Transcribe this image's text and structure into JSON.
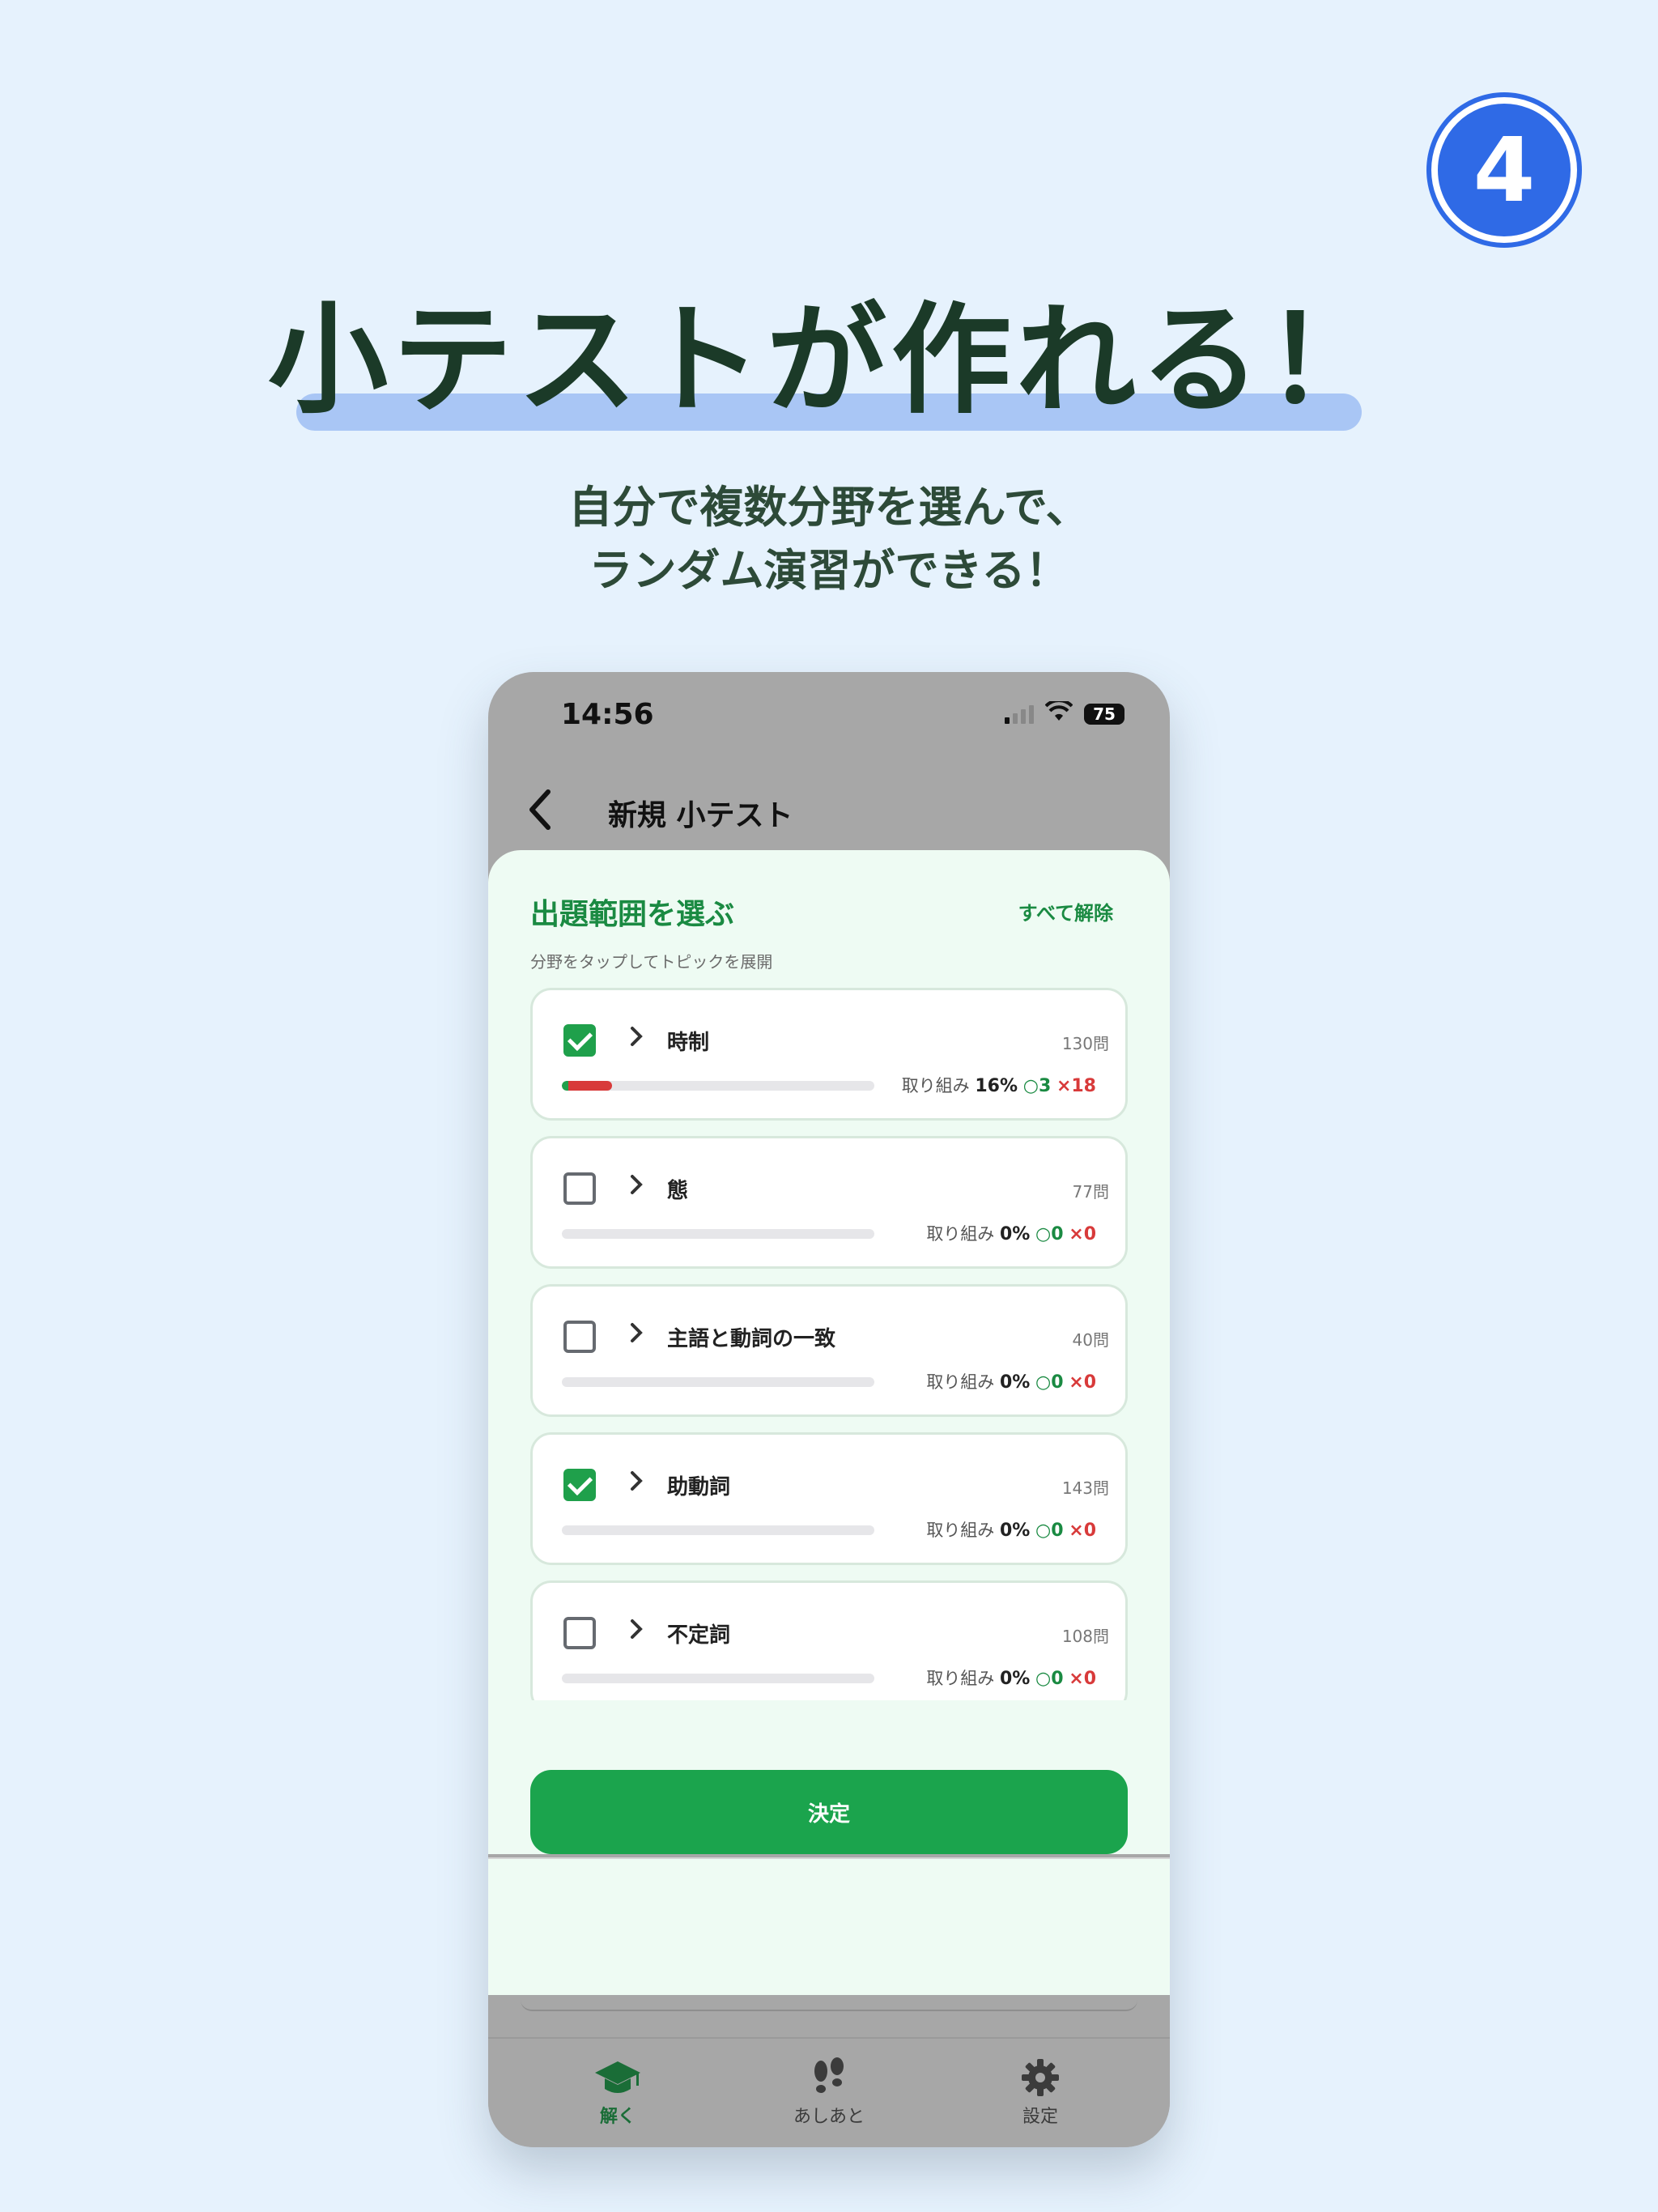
{
  "badge": "4",
  "headline": "小テストが作れる！",
  "subtitle": [
    "自分で複数分野を選んで、",
    "ランダム演習ができる！"
  ],
  "status": {
    "time": "14:56",
    "battery": "75"
  },
  "nav": {
    "title": "新規 小テスト"
  },
  "sheet": {
    "title": "出題範囲を選ぶ",
    "clear_all": "すべて解除",
    "hint": "分野をタップしてトピックを展開",
    "topics": [
      {
        "name": "時制",
        "count": "130問",
        "checked": true,
        "progress_label": "取り組み",
        "progress": "16%",
        "correct": "3",
        "wrong": "18",
        "progress_fraction": 0.16
      },
      {
        "name": "態",
        "count": "77問",
        "checked": false,
        "progress_label": "取り組み",
        "progress": "0%",
        "correct": "0",
        "wrong": "0",
        "progress_fraction": 0
      },
      {
        "name": "主語と動詞の一致",
        "count": "40問",
        "checked": false,
        "progress_label": "取り組み",
        "progress": "0%",
        "correct": "0",
        "wrong": "0",
        "progress_fraction": 0
      },
      {
        "name": "助動詞",
        "count": "143問",
        "checked": true,
        "progress_label": "取り組み",
        "progress": "0%",
        "correct": "0",
        "wrong": "0",
        "progress_fraction": 0
      },
      {
        "name": "不定詞",
        "count": "108問",
        "checked": false,
        "progress_label": "取り組み",
        "progress": "0%",
        "correct": "0",
        "wrong": "0",
        "progress_fraction": 0
      }
    ],
    "decide_label": "決定"
  },
  "tabs": [
    {
      "label": "解く",
      "icon": "graduation-cap-icon",
      "active": true
    },
    {
      "label": "あしあと",
      "icon": "footprints-icon",
      "active": false
    },
    {
      "label": "設定",
      "icon": "gear-icon",
      "active": false
    }
  ],
  "colors": {
    "accent": "#1ba44d",
    "wrong": "#d83a3a",
    "badge": "#2f6ae6",
    "background": "#e6f2fd"
  }
}
